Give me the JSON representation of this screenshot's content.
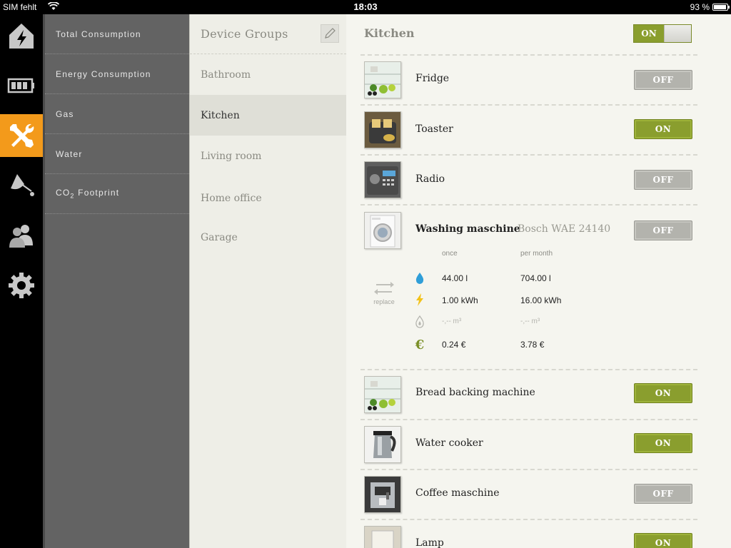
{
  "status_bar": {
    "carrier": "SIM fehlt",
    "time": "18:03",
    "battery": "93 %"
  },
  "rail": {
    "items": [
      {
        "icon": "lightning-house-icon"
      },
      {
        "icon": "battery-icon"
      },
      {
        "icon": "tools-icon",
        "active": true
      },
      {
        "icon": "lamp-icon"
      },
      {
        "icon": "people-icon"
      },
      {
        "icon": "gear-icon"
      }
    ],
    "accent": "#f39a1b"
  },
  "menu": {
    "items": [
      {
        "label": "Total Consumption"
      },
      {
        "label": "Energy Consumption"
      },
      {
        "label": "Gas"
      },
      {
        "label": "Water"
      },
      {
        "label_prefix": "CO",
        "label_sub": "2",
        "label_suffix": " Footprint"
      }
    ]
  },
  "groups": {
    "title": "Device Groups",
    "items": [
      {
        "label": "Bathroom"
      },
      {
        "label": "Kitchen",
        "selected": true
      },
      {
        "label": "Living room"
      },
      {
        "label": "Home office"
      },
      {
        "label": "Garage"
      }
    ]
  },
  "devices": {
    "title": "Kitchen",
    "master_toggle": "ON",
    "on_color": "#8a9e2e",
    "off_color": "#b3b3ad",
    "list": [
      {
        "name": "Fridge",
        "state": "OFF",
        "image": "fridge"
      },
      {
        "name": "Toaster",
        "state": "ON",
        "image": "toaster"
      },
      {
        "name": "Radio",
        "state": "OFF",
        "image": "radio"
      },
      {
        "name": "Washing maschine",
        "model": "Bosch WAE 24140",
        "state": "OFF",
        "image": "washer"
      },
      {
        "name": "Bread backing machine",
        "state": "ON",
        "image": "fridge"
      },
      {
        "name": "Water cooker",
        "state": "ON",
        "image": "kettle"
      },
      {
        "name": "Coffee maschine",
        "state": "OFF",
        "image": "coffee"
      },
      {
        "name": "Lamp",
        "state": "ON",
        "image": "lamp"
      }
    ],
    "detail": {
      "replace_label": "replace",
      "col_once": "once",
      "col_month": "per month",
      "rows": [
        {
          "icon": "water-drop-icon",
          "once": "44.00 l",
          "month": "704.00 l"
        },
        {
          "icon": "lightning-icon",
          "once": "1.00 kWh",
          "month": "16.00 kWh"
        },
        {
          "icon": "gas-flame-icon",
          "once": "-,-- m³",
          "month": "-,-- m³",
          "dim": true
        },
        {
          "icon": "euro-icon",
          "once": "0.24 €",
          "month": "3.78 €"
        }
      ]
    }
  }
}
